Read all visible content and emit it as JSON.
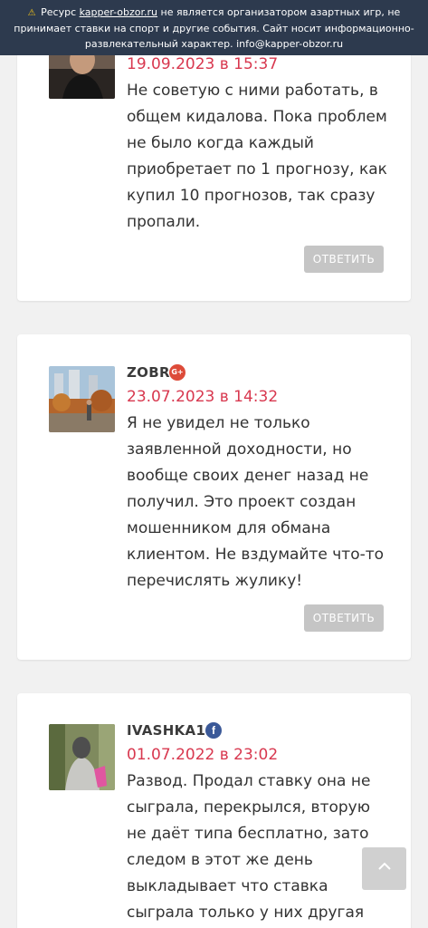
{
  "banner": {
    "prefix": "Ресурс",
    "link": "kapper-obzor.ru",
    "rest": "не является организатором азартных игр, не принимает ставки на спорт и другие события. Сайт носит информационно-развлекательный характер. info@kapper-obzor.ru",
    "warning_icon": "warning-icon"
  },
  "comments": [
    {
      "author": "",
      "date": "19.09.2023 в 15:37",
      "text": "Не советую с ними работать, в общем кидалова. Пока проблем не было когда каждый приобретает по 1 прогнозу, как купил 10 прогнозов, так сразу пропали.",
      "reply_label": "ОТВЕТИТЬ"
    },
    {
      "author": "ZOBR",
      "social": "G+",
      "social_icon": "google-plus-icon",
      "date": "23.07.2023 в 14:32",
      "text": "Я не увидел не только заявленной доходности, но вообще своих денег назад не получил. Это проект создан мошенником для обмана клиентом. Не вздумайте что-то перечислять жулику!",
      "reply_label": "ОТВЕТИТЬ"
    },
    {
      "author": "IVASHKA12",
      "social": "f",
      "social_icon": "facebook-icon",
      "date": "01.07.2022 в 23:02",
      "text": "Развод. Продал ставку она не сыграла, перекрылся, вторую не даёт типа бесплатно, зато следом в этот же день выкладывает что ставка сыграла только у них другая ставка не как",
      "reply_label": "ОТВЕТИТЬ"
    }
  ],
  "scroll_top_icon": "chevron-up-icon",
  "colors": {
    "banner_bg": "#2d3a4e",
    "date": "#d8384f",
    "reply_bg": "#c5c5c5",
    "page_bg": "#f1f1f1"
  }
}
